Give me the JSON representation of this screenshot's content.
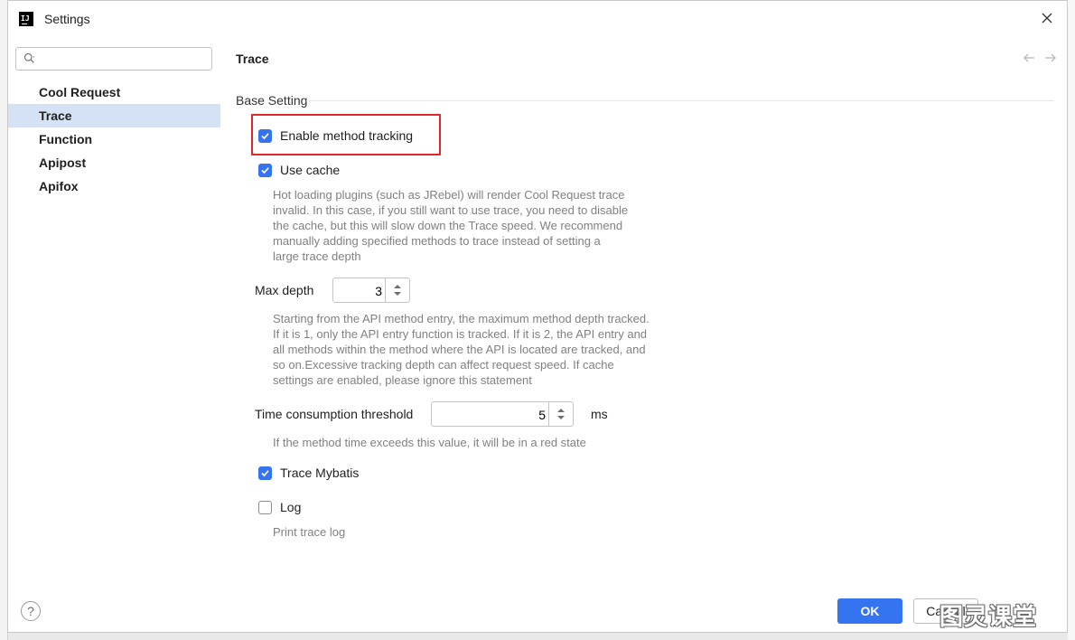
{
  "window": {
    "title": "Settings",
    "app_icon": "intellij-idea-icon"
  },
  "search": {
    "value": "",
    "placeholder": ""
  },
  "sidebar": {
    "items": [
      {
        "label": "Cool Request",
        "active": false
      },
      {
        "label": "Trace",
        "active": true
      },
      {
        "label": "Function",
        "active": false
      },
      {
        "label": "Apipost",
        "active": false
      },
      {
        "label": "Apifox",
        "active": false
      }
    ]
  },
  "page": {
    "title": "Trace",
    "section_title": "Base Setting",
    "enable_tracking": {
      "label": "Enable method tracking",
      "checked": true
    },
    "use_cache": {
      "label": "Use cache",
      "checked": true,
      "help_lines": [
        "Hot loading plugins (such as JRebel) will render Cool Request trace",
        "invalid. In this case, if you still want to use trace, you need to disable",
        "the cache, but this will slow down the Trace speed. We recommend",
        "manually adding specified methods to trace instead of setting a",
        "large trace depth"
      ]
    },
    "max_depth": {
      "label": "Max depth",
      "value": "3",
      "help_lines": [
        "Starting from the API method entry, the maximum method depth tracked.",
        "If it is 1, only the API entry function is tracked. If it is 2, the API entry and",
        "all methods within the method where the API is located are tracked, and",
        "so on.Excessive tracking depth can affect request speed. If cache",
        "settings are enabled, please ignore this statement"
      ]
    },
    "time_threshold": {
      "label": "Time consumption threshold",
      "value": "5",
      "unit": "ms",
      "help": "If the method time exceeds this value, it will be in a red state"
    },
    "trace_mybatis": {
      "label": "Trace Mybatis",
      "checked": true
    },
    "log": {
      "label": "Log",
      "checked": false,
      "help": "Print trace log"
    }
  },
  "footer": {
    "help_label": "?",
    "ok_label": "OK",
    "cancel_label": "Cancel"
  },
  "watermark": "图灵课堂",
  "colors": {
    "accent": "#3574f0",
    "highlight": "#e0262b",
    "active_nav": "#d5e1f5",
    "help_text": "#818181"
  }
}
